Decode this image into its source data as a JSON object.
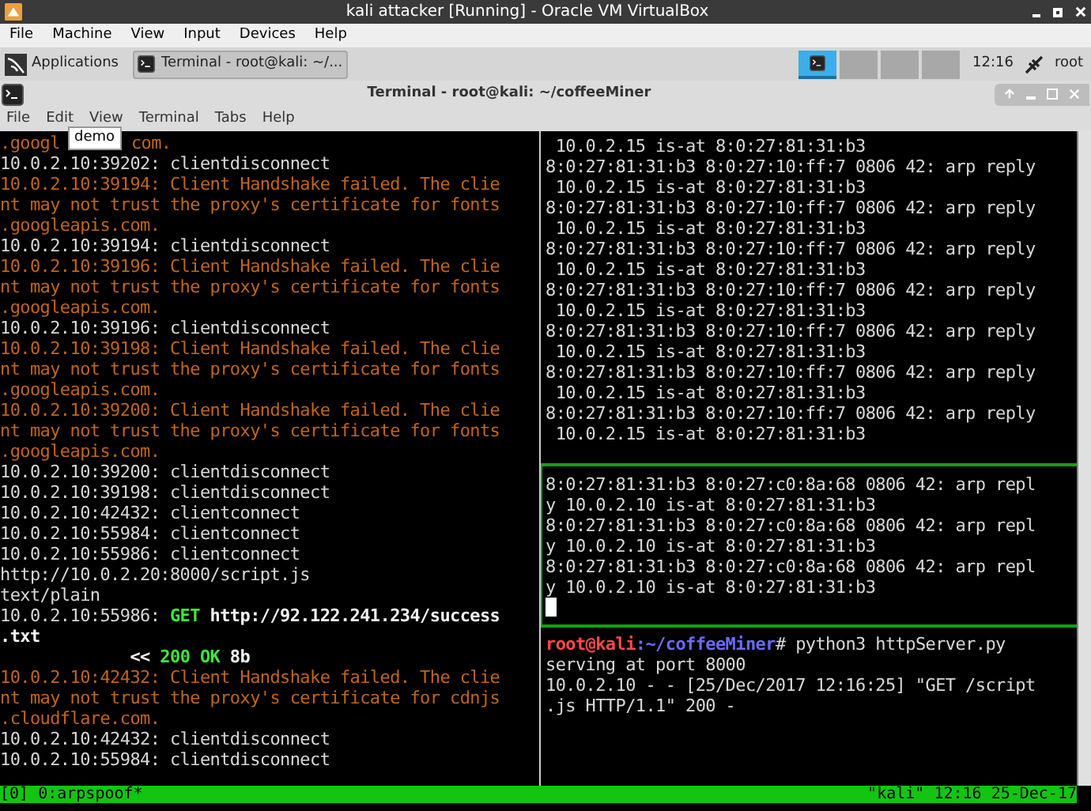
{
  "vm_window": {
    "title": "kali attacker [Running] - Oracle VM VirtualBox",
    "menu": [
      "File",
      "Machine",
      "View",
      "Input",
      "Devices",
      "Help"
    ]
  },
  "panel": {
    "applications": "Applications",
    "task": "Terminal - root@kali: ~/...",
    "workspaces": [
      {
        "selected": true
      },
      {
        "selected": false
      },
      {
        "selected": false
      },
      {
        "selected": false
      }
    ],
    "clock": "12:16",
    "user": "root"
  },
  "terminal": {
    "title": "Terminal - root@kali: ~/coffeeMiner",
    "menu": [
      "File",
      "Edit",
      "View",
      "Terminal",
      "Tabs",
      "Help"
    ],
    "tooltip": "demo",
    "left_pane": [
      [
        {
          "kind": "warning",
          "text": ".googl"
        },
        {
          "kind": "gap"
        },
        {
          "kind": "warning",
          "text": "com."
        }
      ],
      [
        {
          "kind": "plain",
          "text": "10.0.2.10:39202: clientdisconnect"
        }
      ],
      [
        {
          "kind": "warning",
          "text": "10.0.2.10:39194: Client Handshake failed. The clie"
        }
      ],
      [
        {
          "kind": "warning",
          "text": "nt may not trust the proxy's certificate for fonts"
        }
      ],
      [
        {
          "kind": "warning",
          "text": ".googleapis.com."
        }
      ],
      [
        {
          "kind": "plain",
          "text": "10.0.2.10:39194: clientdisconnect"
        }
      ],
      [
        {
          "kind": "warning",
          "text": "10.0.2.10:39196: Client Handshake failed. The clie"
        }
      ],
      [
        {
          "kind": "warning",
          "text": "nt may not trust the proxy's certificate for fonts"
        }
      ],
      [
        {
          "kind": "warning",
          "text": ".googleapis.com."
        }
      ],
      [
        {
          "kind": "plain",
          "text": "10.0.2.10:39196: clientdisconnect"
        }
      ],
      [
        {
          "kind": "warning",
          "text": "10.0.2.10:39198: Client Handshake failed. The clie"
        }
      ],
      [
        {
          "kind": "warning",
          "text": "nt may not trust the proxy's certificate for fonts"
        }
      ],
      [
        {
          "kind": "warning",
          "text": ".googleapis.com."
        }
      ],
      [
        {
          "kind": "warning",
          "text": "10.0.2.10:39200: Client Handshake failed. The clie"
        }
      ],
      [
        {
          "kind": "warning",
          "text": "nt may not trust the proxy's certificate for fonts"
        }
      ],
      [
        {
          "kind": "warning",
          "text": ".googleapis.com."
        }
      ],
      [
        {
          "kind": "plain",
          "text": "10.0.2.10:39200: clientdisconnect"
        }
      ],
      [
        {
          "kind": "plain",
          "text": "10.0.2.10:39198: clientdisconnect"
        }
      ],
      [
        {
          "kind": "plain",
          "text": "10.0.2.10:42432: clientconnect"
        }
      ],
      [
        {
          "kind": "plain",
          "text": "10.0.2.10:55984: clientconnect"
        }
      ],
      [
        {
          "kind": "plain",
          "text": "10.0.2.10:55986: clientconnect"
        }
      ],
      [
        {
          "kind": "plain",
          "text": "http://10.0.2.20:8000/script.js"
        }
      ],
      [
        {
          "kind": "plain",
          "text": "text/plain"
        }
      ],
      [
        {
          "kind": "plain",
          "text": "10.0.2.10:55986: "
        },
        {
          "kind": "ok",
          "text": "GET"
        },
        {
          "kind": "bold",
          "text": " http://92.122.241.234/success"
        }
      ],
      [
        {
          "kind": "bold",
          "text": ".txt"
        }
      ],
      [
        {
          "kind": "bold",
          "text": "             << "
        },
        {
          "kind": "ok",
          "text": "200 OK"
        },
        {
          "kind": "bold",
          "text": " 8b"
        }
      ],
      [
        {
          "kind": "warning",
          "text": "10.0.2.10:42432: Client Handshake failed. The clie"
        }
      ],
      [
        {
          "kind": "warning",
          "text": "nt may not trust the proxy's certificate for cdnjs"
        }
      ],
      [
        {
          "kind": "warning",
          "text": ".cloudflare.com."
        }
      ],
      [
        {
          "kind": "plain",
          "text": "10.0.2.10:42432: clientdisconnect"
        }
      ],
      [
        {
          "kind": "plain",
          "text": "10.0.2.10:55984: clientdisconnect"
        }
      ]
    ],
    "right_top_pane": [
      " 10.0.2.15 is-at 8:0:27:81:31:b3",
      "8:0:27:81:31:b3 8:0:27:10:ff:7 0806 42: arp reply",
      " 10.0.2.15 is-at 8:0:27:81:31:b3",
      "8:0:27:81:31:b3 8:0:27:10:ff:7 0806 42: arp reply",
      " 10.0.2.15 is-at 8:0:27:81:31:b3",
      "8:0:27:81:31:b3 8:0:27:10:ff:7 0806 42: arp reply",
      " 10.0.2.15 is-at 8:0:27:81:31:b3",
      "8:0:27:81:31:b3 8:0:27:10:ff:7 0806 42: arp reply",
      " 10.0.2.15 is-at 8:0:27:81:31:b3",
      "8:0:27:81:31:b3 8:0:27:10:ff:7 0806 42: arp reply",
      " 10.0.2.15 is-at 8:0:27:81:31:b3",
      "8:0:27:81:31:b3 8:0:27:10:ff:7 0806 42: arp reply",
      " 10.0.2.15 is-at 8:0:27:81:31:b3",
      "8:0:27:81:31:b3 8:0:27:10:ff:7 0806 42: arp reply",
      " 10.0.2.15 is-at 8:0:27:81:31:b3"
    ],
    "right_middle_pane": [
      "8:0:27:81:31:b3 8:0:27:c0:8a:68 0806 42: arp repl",
      "y 10.0.2.10 is-at 8:0:27:81:31:b3",
      "8:0:27:81:31:b3 8:0:27:c0:8a:68 0806 42: arp repl",
      "y 10.0.2.10 is-at 8:0:27:81:31:b3",
      "8:0:27:81:31:b3 8:0:27:c0:8a:68 0806 42: arp repl",
      "y 10.0.2.10 is-at 8:0:27:81:31:b3"
    ],
    "right_bottom_pane": {
      "prompt_user": "root@kali",
      "prompt_path": ":~/coffeeMiner",
      "prompt_command": "# python3 httpServer.py",
      "lines": [
        "serving at port 8000",
        "10.0.2.10 - - [25/Dec/2017 12:16:25] \"GET /script",
        ".js HTTP/1.1\" 200 -"
      ]
    },
    "status_bar": {
      "left": "[0] 0:arpspoof*",
      "right": "\"kali\" 12:16 25-Dec-17"
    }
  }
}
